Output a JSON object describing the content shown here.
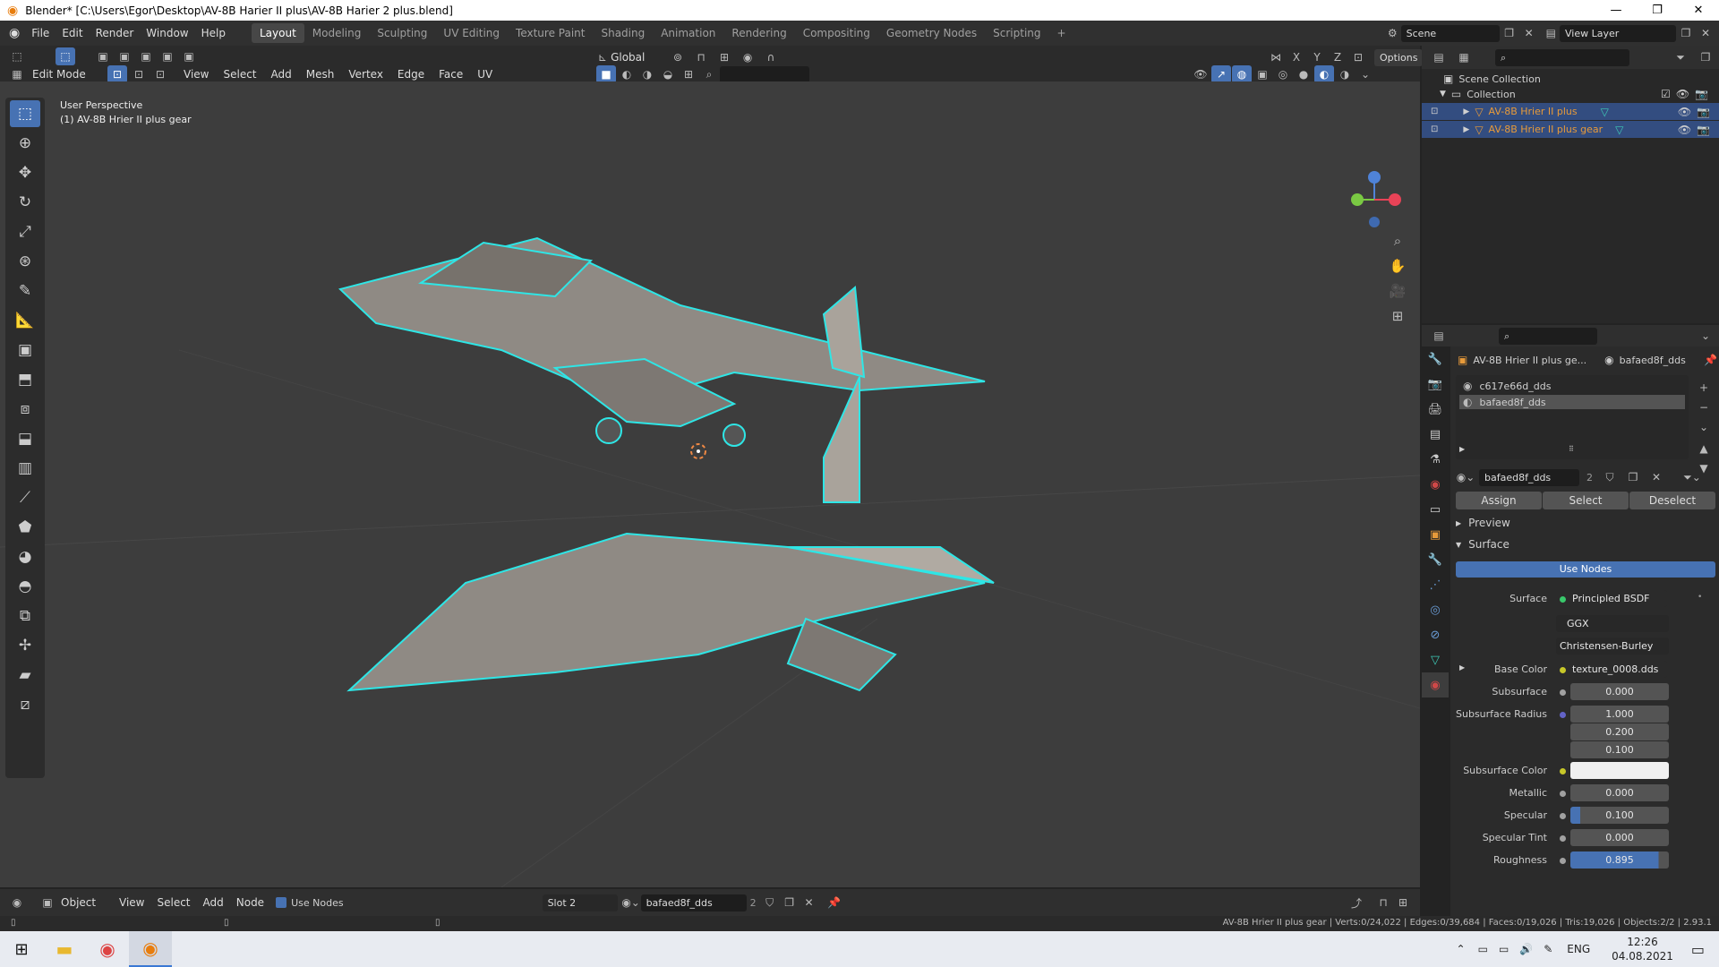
{
  "titlebar": {
    "title": "Blender* [C:\\Users\\Egor\\Desktop\\AV-8B Harier II plus\\AV-8B Harier 2 plus.blend]"
  },
  "menus": [
    "File",
    "Edit",
    "Render",
    "Window",
    "Help"
  ],
  "workspaces": [
    "Layout",
    "Modeling",
    "Sculpting",
    "UV Editing",
    "Texture Paint",
    "Shading",
    "Animation",
    "Rendering",
    "Compositing",
    "Geometry Nodes",
    "Scripting"
  ],
  "active_workspace": "Layout",
  "scene": "Scene",
  "view_layer": "View Layer",
  "viewport": {
    "transform_orientation": "Global",
    "options_label": "Options",
    "mode": "Edit Mode",
    "menus": [
      "View",
      "Select",
      "Add",
      "Mesh",
      "Vertex",
      "Edge",
      "Face",
      "UV"
    ],
    "axes": [
      "X",
      "Y",
      "Z"
    ],
    "overlay_title": "User Perspective",
    "overlay_object": "(1) AV-8B Hrier II plus gear",
    "wire_color": "#2ee6e6"
  },
  "outliner": {
    "root": "Scene Collection",
    "collection": "Collection",
    "objects": [
      "AV-8B Hrier II plus",
      "AV-8B Hrier II plus gear"
    ]
  },
  "properties": {
    "object_name": "AV-8B Hrier II plus ge...",
    "material_name": "bafaed8f_dds",
    "slots": [
      "c617e66d_dds",
      "bafaed8f_dds"
    ],
    "material_field": "bafaed8f_dds",
    "users": "2",
    "assign": "Assign",
    "select": "Select",
    "deselect": "Deselect",
    "preview": "Preview",
    "surface_panel": "Surface",
    "use_nodes": "Use Nodes",
    "surface_label": "Surface",
    "surface_value": "Principled BSDF",
    "distribution": "GGX",
    "subsurface_method": "Christensen-Burley",
    "fields": [
      {
        "label": "Base Color",
        "value": "texture_0008.dds"
      },
      {
        "label": "Subsurface",
        "value": "0.000"
      },
      {
        "label": "Subsurface Radius",
        "values": [
          "1.000",
          "0.200",
          "0.100"
        ]
      },
      {
        "label": "Subsurface Color",
        "value": ""
      },
      {
        "label": "Metallic",
        "value": "0.000"
      },
      {
        "label": "Specular",
        "value": "0.100"
      },
      {
        "label": "Specular Tint",
        "value": "0.000"
      },
      {
        "label": "Roughness",
        "value": "0.895"
      }
    ]
  },
  "node_header": {
    "editor": "Object",
    "menus": [
      "View",
      "Select",
      "Add",
      "Node"
    ],
    "use_nodes": "Use Nodes",
    "slot": "Slot 2",
    "material": "bafaed8f_dds",
    "users": "2"
  },
  "status": {
    "text": "AV-8B Hrier II plus gear | Verts:0/24,022 | Edges:0/39,684 | Faces:0/19,026 | Tris:19,026 | Objects:2/2 | 2.93.1"
  },
  "taskbar": {
    "lang": "ENG",
    "time": "12:26",
    "date": "04.08.2021"
  }
}
